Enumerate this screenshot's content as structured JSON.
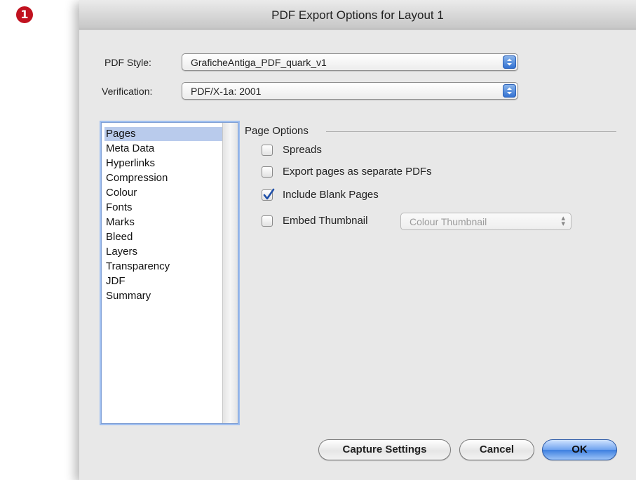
{
  "step_badge": "1",
  "window": {
    "title": "PDF Export Options for Layout 1"
  },
  "pdf_style": {
    "label": "PDF Style:",
    "value": "GraficheAntiga_PDF_quark_v1"
  },
  "verification": {
    "label": "Verification:",
    "value": "PDF/X-1a: 2001"
  },
  "sidebar": {
    "items": [
      {
        "label": "Pages",
        "selected": true
      },
      {
        "label": "Meta Data",
        "selected": false
      },
      {
        "label": "Hyperlinks",
        "selected": false
      },
      {
        "label": "Compression",
        "selected": false
      },
      {
        "label": "Colour",
        "selected": false
      },
      {
        "label": "Fonts",
        "selected": false
      },
      {
        "label": "Marks",
        "selected": false
      },
      {
        "label": "Bleed",
        "selected": false
      },
      {
        "label": "Layers",
        "selected": false
      },
      {
        "label": "Transparency",
        "selected": false
      },
      {
        "label": "JDF",
        "selected": false
      },
      {
        "label": "Summary",
        "selected": false
      }
    ]
  },
  "page_options": {
    "title": "Page Options",
    "spreads": {
      "label": "Spreads",
      "checked": false
    },
    "separate_pdfs": {
      "label": "Export pages as separate PDFs",
      "checked": false
    },
    "blank_pages": {
      "label": "Include Blank Pages",
      "checked": true
    },
    "embed_thumbnail": {
      "label": "Embed Thumbnail",
      "checked": false
    },
    "thumbnail_type": {
      "value": "Colour Thumbnail",
      "enabled": false
    }
  },
  "buttons": {
    "capture_settings": "Capture Settings",
    "cancel": "Cancel",
    "ok": "OK"
  },
  "colors": {
    "accent_blue": "#3d7fe0",
    "selection": "#b9cbec",
    "badge_red": "#c1121f"
  },
  "icons": {
    "popup_arrows": "up-down-chevron-icon",
    "checkmark": "checkmark-icon"
  }
}
